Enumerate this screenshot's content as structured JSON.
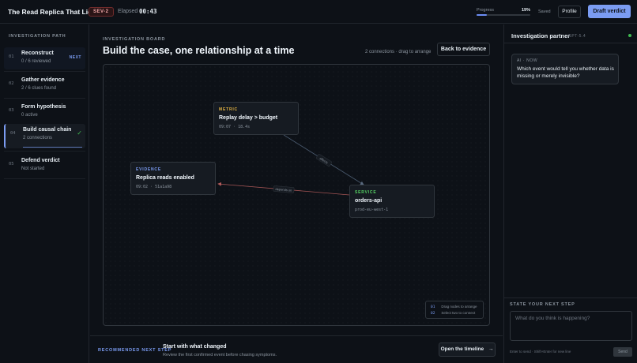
{
  "header": {
    "app_title": "The Read Replica That Lied",
    "severity": "SEV-2",
    "elapsed_label": "Elapsed",
    "elapsed_value": "00:43",
    "progress_label": "Progress",
    "progress_value": "19%",
    "progress_fraction": 0.19,
    "saved_label": "Saved",
    "profile_label": "Profile",
    "draft_verdict_label": "Draft verdict"
  },
  "sidebar": {
    "heading": "INVESTIGATION PATH",
    "steps": [
      {
        "num": "01",
        "title": "Reconstruct",
        "sub": "0 / 6 reviewed",
        "badge": "NEXT"
      },
      {
        "num": "02",
        "title": "Gather evidence",
        "sub": "2 / 6 clues found"
      },
      {
        "num": "03",
        "title": "Form hypothesis",
        "sub": "0 active"
      },
      {
        "num": "04",
        "title": "Build causal chain",
        "sub": "2 connections",
        "done_icon": "check-icon"
      },
      {
        "num": "05",
        "title": "Defend verdict",
        "sub": "Not started"
      }
    ]
  },
  "board": {
    "label": "INVESTIGATION BOARD",
    "title": "Build the case, one relationship at a time",
    "connections_hint": "2 connections · drag to arrange",
    "back_label": "Back to evidence",
    "nodes": {
      "metric": {
        "kind": "METRIC",
        "title": "Replay delay > budget",
        "meta": "09:07 · 18.4s"
      },
      "evidence": {
        "kind": "EVIDENCE",
        "title": "Replica reads enabled",
        "meta": "09:02 · 51a1a98"
      },
      "service": {
        "kind": "SERVICE",
        "title": "orders-api",
        "meta": "prod-eu-west-1"
      }
    },
    "edges": [
      {
        "from": "metric",
        "to": "service",
        "label": "affects"
      },
      {
        "from": "service",
        "to": "evidence",
        "label": "depends on"
      }
    ],
    "legend": [
      {
        "key": "01",
        "text": "Drag nodes to arrange"
      },
      {
        "key": "02",
        "text": "Select two to connect"
      }
    ],
    "colors": {
      "metric": "#e3b341",
      "evidence": "#7b9cf2",
      "service": "#56d364",
      "edge_dark": "#4a5a6e",
      "edge_red": "#a35454"
    }
  },
  "recommendation": {
    "label": "RECOMMENDED NEXT STEP",
    "title": "Start with what changed",
    "subtitle": "Review the first confirmed event before chasing symptoms.",
    "button_label": "Open the timeline",
    "button_icon": "arrow-right-icon"
  },
  "partner": {
    "title": "Investigation partner",
    "model": "GPT-5.4",
    "message_who": "AI · NOW",
    "message": "Which event would tell you whether data is missing or merely invisible?",
    "next_step_label": "STATE YOUR NEXT STEP",
    "input_placeholder": "What do you think is happening?",
    "input_hint": "Enter to send · Shift+Enter for new line",
    "send_label": "Send"
  },
  "accent_color": "#7b9cf2"
}
